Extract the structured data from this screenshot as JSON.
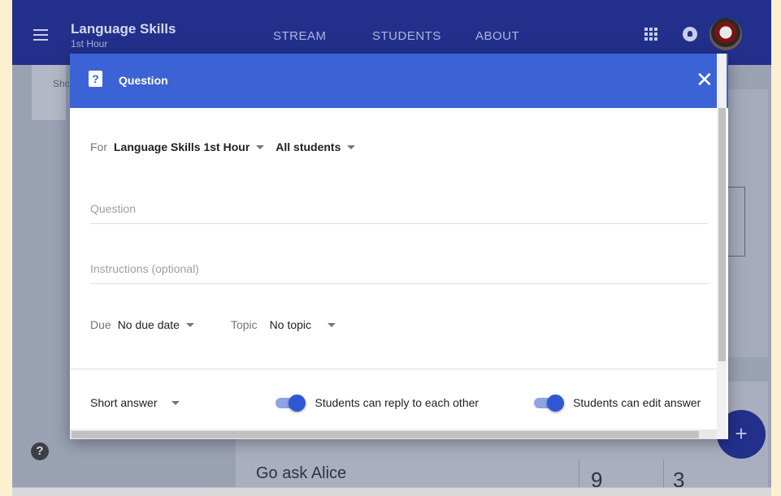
{
  "topbar": {
    "class_title": "Language Skills",
    "class_subtitle": "1st Hour",
    "tabs": [
      "STREAM",
      "STUDENTS",
      "ABOUT"
    ]
  },
  "background": {
    "truncated_text": "Shc",
    "post_title": "Go ask Alice",
    "count_a": "9",
    "count_b": "3",
    "help_glyph": "?",
    "fab_glyph": "+"
  },
  "dialog": {
    "title": "Question",
    "icon_glyph": "?",
    "close_glyph": "✕",
    "for_label": "For",
    "class_value": "Language Skills 1st Hour",
    "audience_value": "All students",
    "question_placeholder": "Question",
    "instructions_placeholder": "Instructions (optional)",
    "due_label": "Due",
    "due_value": "No due date",
    "topic_label": "Topic",
    "topic_value": "No topic",
    "answer_type": "Short answer",
    "toggle_reply_label": "Students can reply to each other",
    "toggle_reply_on": true,
    "toggle_edit_label": "Students can edit answer",
    "toggle_edit_on": true
  },
  "colors": {
    "topbar": "#22308c",
    "dialog_header": "#3c63d6",
    "toggle_knob": "#2f57d4"
  }
}
